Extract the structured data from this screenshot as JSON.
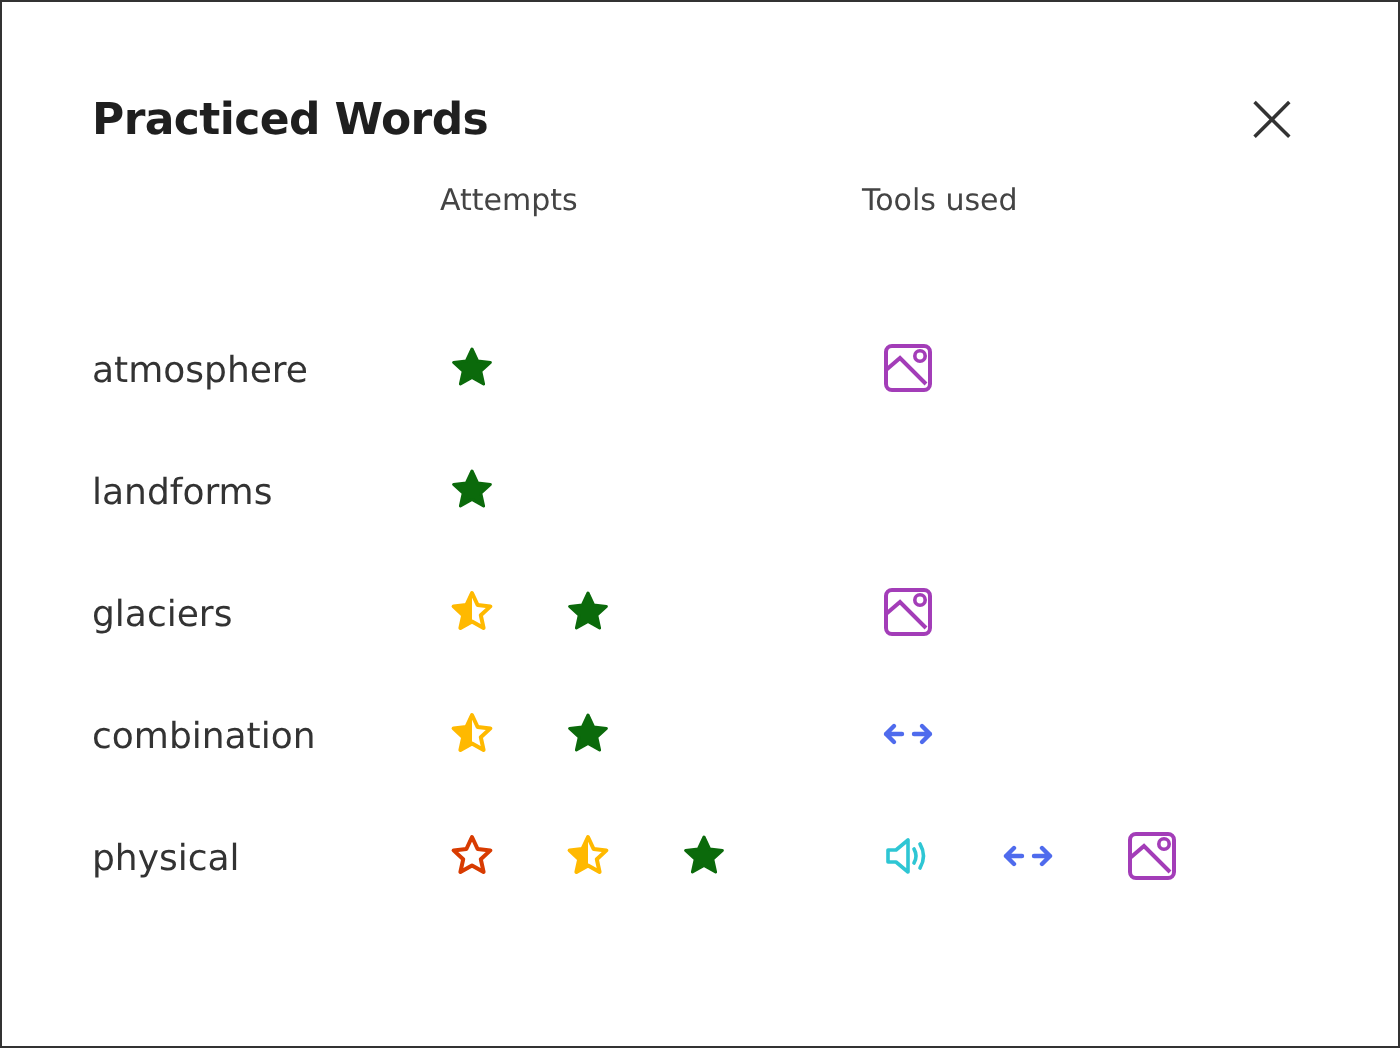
{
  "dialog": {
    "title": "Practiced Words",
    "close": "×"
  },
  "columns": [
    "Attempts",
    "Tools used"
  ],
  "rows": [
    {
      "word": "atmosphere",
      "attempts": [
        {
          "kind": "full"
        }
      ],
      "tools": [
        {
          "kind": "picture"
        }
      ]
    },
    {
      "word": "landforms",
      "attempts": [
        {
          "kind": "full"
        }
      ],
      "tools": []
    },
    {
      "word": "glaciers",
      "attempts": [
        {
          "kind": "half"
        },
        {
          "kind": "full"
        }
      ],
      "tools": [
        {
          "kind": "picture"
        }
      ]
    },
    {
      "word": "combination",
      "attempts": [
        {
          "kind": "half"
        },
        {
          "kind": "full"
        }
      ],
      "tools": [
        {
          "kind": "arrows"
        }
      ]
    },
    {
      "word": "physical",
      "attempts": [
        {
          "kind": "outline"
        },
        {
          "kind": "half"
        },
        {
          "kind": "full"
        }
      ],
      "tools": [
        {
          "kind": "audio"
        },
        {
          "kind": "arrows"
        },
        {
          "kind": "picture"
        }
      ]
    }
  ]
}
